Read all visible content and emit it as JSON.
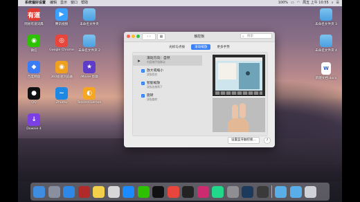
{
  "menubar": {
    "app_name": "系统偏好设置",
    "items": [
      "编辑",
      "显示",
      "窗口",
      "帮助"
    ],
    "status": {
      "battery": "100%",
      "datetime": "周五 上午 10:55"
    }
  },
  "desktop_icons_left": [
    {
      "label": "网易有道词典",
      "icon": "youdao-icon",
      "color": "#e03b32",
      "glyph": "有道"
    },
    {
      "label": "腾讯视频",
      "icon": "tencent-video-icon",
      "color": "#3aa0ff",
      "glyph": "▶"
    },
    {
      "label": "未命名文件夹",
      "icon": "folder-icon",
      "color": "#5aaee8",
      "glyph": ""
    },
    {
      "label": "微信",
      "icon": "wechat-icon",
      "color": "#2dc100",
      "glyph": "◉"
    },
    {
      "label": "Google Chrome",
      "icon": "chrome-icon",
      "color": "#e8453c",
      "glyph": "◎"
    },
    {
      "label": "未命名文件夹 2",
      "icon": "folder-icon",
      "color": "#5aaee8",
      "glyph": ""
    },
    {
      "label": "百度网盘",
      "icon": "baidu-netdisk-icon",
      "color": "#3a7bf6",
      "glyph": "◆"
    },
    {
      "label": "360极速浏览器",
      "icon": "360-browser-icon",
      "color": "#f0a020",
      "glyph": "◉"
    },
    {
      "label": "iMovie 剪辑",
      "icon": "imovie-icon",
      "color": "#5e3bc8",
      "glyph": "★"
    },
    {
      "label": "QQ",
      "icon": "qq-icon",
      "color": "#111111",
      "glyph": "●"
    },
    {
      "label": "Zhumu",
      "icon": "zhumu-icon",
      "color": "#1e88e5",
      "glyph": "~"
    },
    {
      "label": "Tencent Lemon",
      "icon": "lemon-icon",
      "color": "#f5a623",
      "glyph": "◐"
    },
    {
      "label": "Downie 4",
      "icon": "downie-icon",
      "color": "#7b3fe4",
      "glyph": "↓"
    }
  ],
  "desktop_icons_right": [
    {
      "label": "未命名文件夹 3",
      "icon": "folder-icon"
    },
    {
      "label": "未命名文件夹 4",
      "icon": "folder-icon"
    },
    {
      "label": "新建文档.docx",
      "icon": "word-doc-icon"
    }
  ],
  "window": {
    "title": "触控板",
    "search_placeholder": "搜索",
    "grid_button": "▦",
    "tabs": [
      {
        "label": "光标与点按",
        "active": false
      },
      {
        "label": "滚动缩放",
        "active": true
      },
      {
        "label": "更多手势",
        "active": false
      }
    ],
    "gestures": [
      {
        "title": "滚动方向：自然",
        "subtitle": "内容随手指移动",
        "checked": false,
        "selected": true
      },
      {
        "title": "放大或缩小",
        "subtitle": "双指捏合",
        "checked": true,
        "selected": false
      },
      {
        "title": "智能缩放",
        "subtitle": "双指连按两下",
        "checked": true,
        "selected": false
      },
      {
        "title": "旋转",
        "subtitle": "双指旋转",
        "checked": true,
        "selected": false
      }
    ],
    "setup_button": "设置蓝牙触控板…",
    "help": "?"
  },
  "dock": [
    {
      "name": "finder-icon",
      "color": "#3e8de0"
    },
    {
      "name": "launchpad-icon",
      "color": "#8a8fa0"
    },
    {
      "name": "safari-icon",
      "color": "#2d88e6"
    },
    {
      "name": "photo-booth-icon",
      "color": "#b02a2a"
    },
    {
      "name": "notes-icon",
      "color": "#f2d04a"
    },
    {
      "name": "preview-icon",
      "color": "#d7d7d7"
    },
    {
      "name": "app-store-icon",
      "color": "#1a8cff"
    },
    {
      "name": "wechat-icon",
      "color": "#2dc100"
    },
    {
      "name": "qq-icon",
      "color": "#111111"
    },
    {
      "name": "chrome-icon",
      "color": "#e8453c"
    },
    {
      "name": "terminal-icon",
      "color": "#222222"
    },
    {
      "name": "intellij-icon",
      "color": "#cc2c6f"
    },
    {
      "name": "pycharm-icon",
      "color": "#21d789"
    },
    {
      "name": "system-preferences-icon",
      "color": "#8e8e93"
    },
    {
      "name": "quicktime-icon",
      "color": "#1c3a5c"
    },
    {
      "name": "screenshot-icon",
      "color": "#3a3a3a"
    },
    {
      "name": "folder-icon",
      "color": "#5aaee8"
    },
    {
      "name": "downloads-folder-icon",
      "color": "#5aaee8"
    },
    {
      "name": "trash-icon",
      "color": "#cfd3d8"
    }
  ]
}
